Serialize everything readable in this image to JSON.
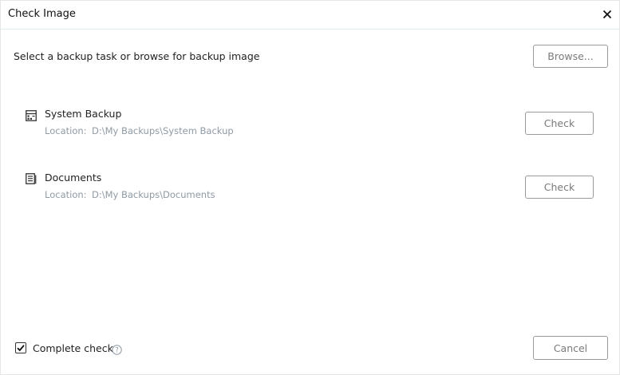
{
  "window": {
    "title": "Check Image"
  },
  "header": {
    "instruction": "Select a backup task or browse for backup image",
    "browse_label": "Browse..."
  },
  "tasks": [
    {
      "name": "System Backup",
      "location_label": "Location:",
      "location": "D:\\My Backups\\System Backup",
      "check_label": "Check",
      "icon": "system-backup-icon"
    },
    {
      "name": "Documents",
      "location_label": "Location:",
      "location": "D:\\My Backups\\Documents",
      "check_label": "Check",
      "icon": "document-icon"
    }
  ],
  "footer": {
    "complete_check_label": "Complete check",
    "complete_check_checked": true,
    "cancel_label": "Cancel"
  },
  "colors": {
    "accent_divider": "#dbeef0",
    "muted_text": "#8f9aa5",
    "button_border": "#9a9a9a"
  }
}
